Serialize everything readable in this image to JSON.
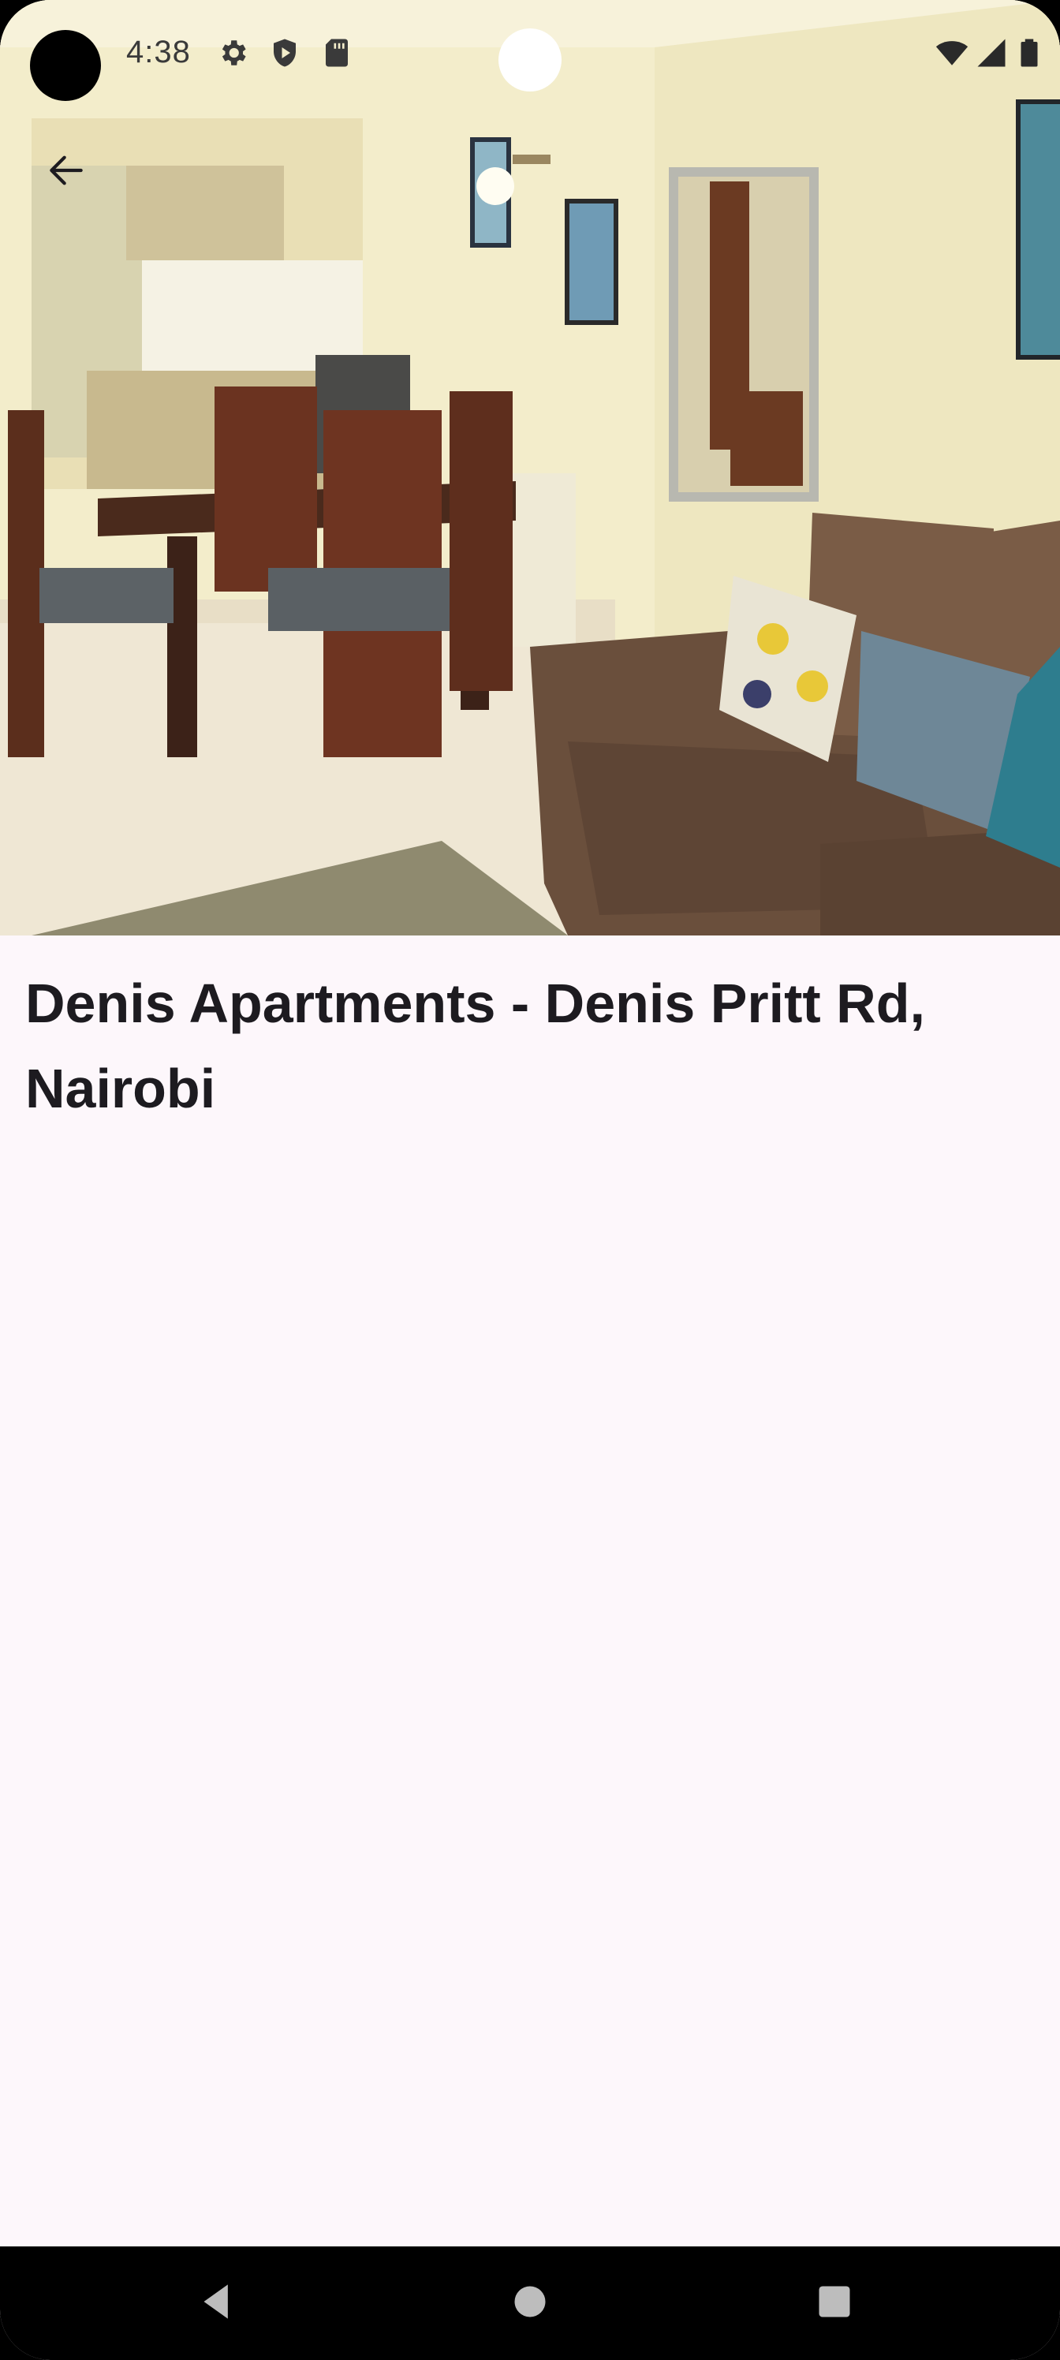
{
  "status_bar": {
    "time": "4:38",
    "left_icons": [
      "settings-icon",
      "shield-play-icon",
      "sd-card-icon"
    ],
    "right_icons": [
      "wifi-icon",
      "cellular-signal-icon",
      "battery-icon"
    ]
  },
  "toolbar": {
    "back_icon": "arrow-back-icon"
  },
  "listing": {
    "title": "Denis Apartments - Denis Pritt Rd, Nairobi"
  },
  "hero_image": {
    "subject": "apartment-living-dining-room-photo"
  },
  "nav_bar": {
    "buttons": [
      "back-triangle-icon",
      "home-circle-icon",
      "recents-square-icon"
    ]
  },
  "colors": {
    "background": "#fdf7fb",
    "title_text": "#1d1b20",
    "nav_bar": "#000000"
  }
}
